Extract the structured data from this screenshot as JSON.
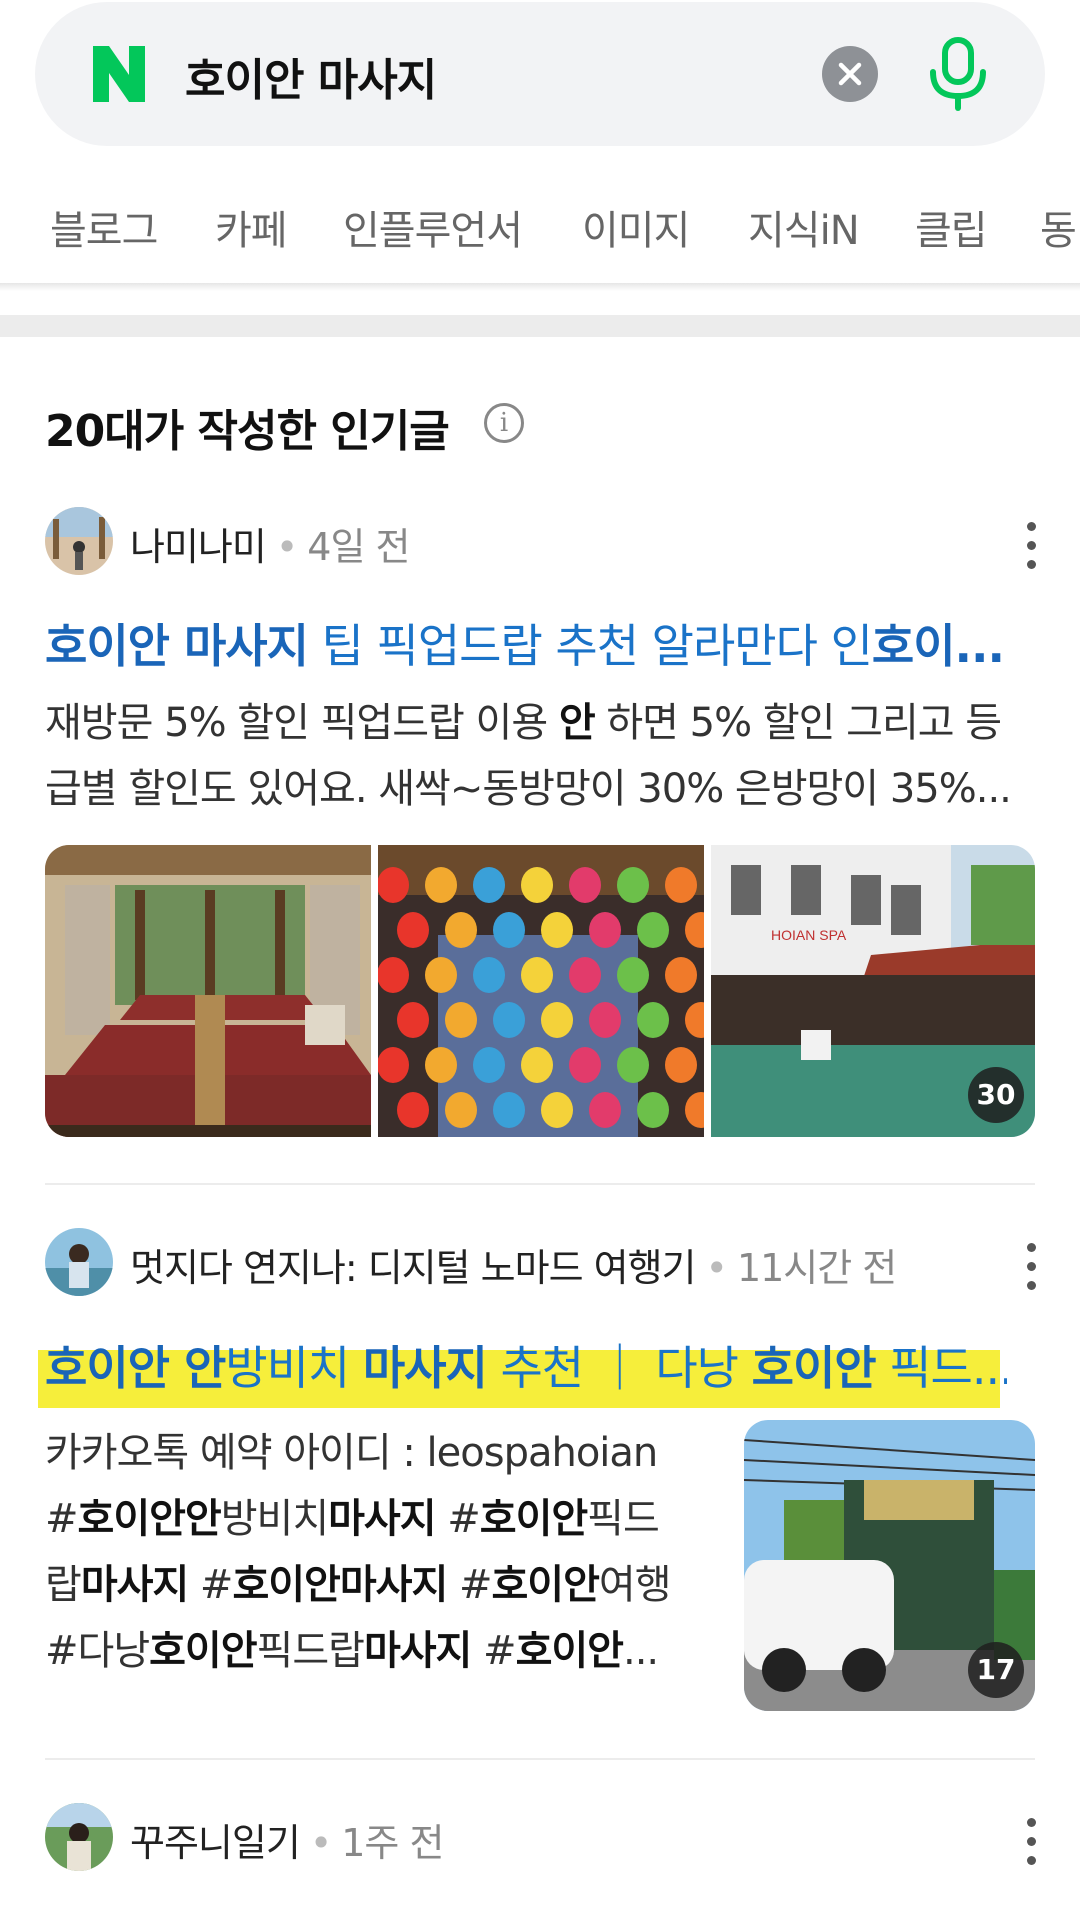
{
  "search": {
    "query": "호이안 마사지"
  },
  "tabs": [
    "블로그",
    "카페",
    "인플루언서",
    "이미지",
    "지식iN",
    "클립",
    "동"
  ],
  "section": {
    "title": "20대가 작성한 인기글"
  },
  "posts": [
    {
      "author": "나미나미",
      "time": "4일 전",
      "title": [
        {
          "t": "호이안 마사지",
          "b": true
        },
        {
          "t": " 팁 픽업드랍 추천 알라만다 인",
          "b": false
        },
        {
          "t": "호이...",
          "b": true
        }
      ],
      "snippet_lines": [
        [
          {
            "t": "재방문 5% 할인 픽업드랍 이용 ",
            "b": false
          },
          {
            "t": "안",
            "b": true
          },
          {
            "t": " 하면 5% 할인 그리고 등",
            "b": false
          }
        ],
        [
          {
            "t": "급별 할인도 있어요. 새싹~동방망이 30% 은방망이 35%...",
            "b": false
          }
        ]
      ],
      "image_count": "30"
    },
    {
      "author": "멋지다 연지나: 디지털 노마드 여행기",
      "time": "11시간 전",
      "title": [
        {
          "t": "호이안 안",
          "b": true
        },
        {
          "t": "방비치 ",
          "b": false
        },
        {
          "t": "마사지",
          "b": true
        },
        {
          "t": " 추천 ｜ 다낭 ",
          "b": false
        },
        {
          "t": "호이안",
          "b": true
        },
        {
          "t": " 픽드...",
          "b": false
        }
      ],
      "snippet_lines": [
        [
          {
            "t": "카카오톡 예약 아이디 : leospahoian",
            "b": false
          }
        ],
        [
          {
            "t": "#",
            "b": false
          },
          {
            "t": "호이안안",
            "b": true
          },
          {
            "t": "방비치",
            "b": false
          },
          {
            "t": "마사지",
            "b": true
          },
          {
            "t": " #",
            "b": false
          },
          {
            "t": "호이안",
            "b": true
          },
          {
            "t": "픽드",
            "b": false
          }
        ],
        [
          {
            "t": "랍",
            "b": false
          },
          {
            "t": "마사지",
            "b": true
          },
          {
            "t": " #",
            "b": false
          },
          {
            "t": "호이안마사지",
            "b": true
          },
          {
            "t": " #",
            "b": false
          },
          {
            "t": "호이안",
            "b": true
          },
          {
            "t": "여행",
            "b": false
          }
        ],
        [
          {
            "t": "#다낭",
            "b": false
          },
          {
            "t": "호이안",
            "b": true
          },
          {
            "t": "픽드랍",
            "b": false
          },
          {
            "t": "마사지",
            "b": true
          },
          {
            "t": " #",
            "b": false
          },
          {
            "t": "호이안",
            "b": true
          },
          {
            "t": "...",
            "b": false
          }
        ]
      ],
      "image_count": "17"
    },
    {
      "author": "꾸주니일기",
      "time": "1주 전"
    }
  ]
}
